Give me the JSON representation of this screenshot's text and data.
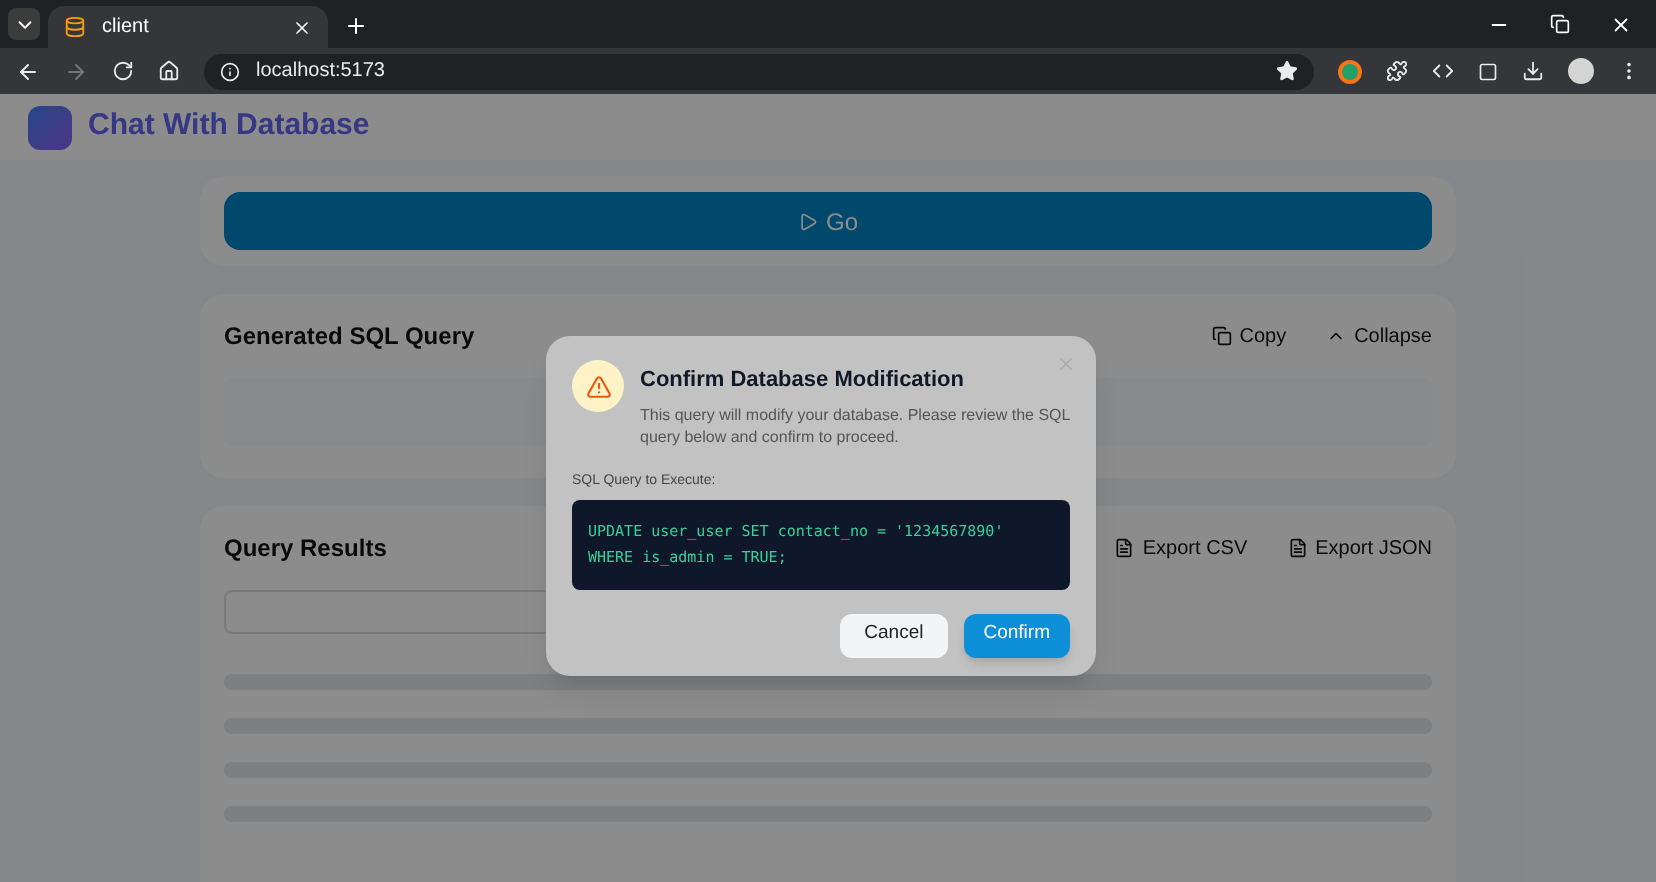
{
  "browser": {
    "tab_title": "client",
    "address": "localhost:5173"
  },
  "page": {
    "app_title": "Chat With Database",
    "go_button": "Go",
    "sql_card": {
      "title": "Generated SQL Query",
      "copy": "Copy",
      "collapse": "Collapse"
    },
    "results_card": {
      "title": "Query Results",
      "export_csv": "Export CSV",
      "export_json": "Export JSON"
    }
  },
  "dialog": {
    "title": "Confirm Database Modification",
    "message": "This query will modify your database. Please review the SQL query below and confirm to proceed.",
    "query_label": "SQL Query to Execute:",
    "query_lines": [
      "UPDATE user_user SET contact_no = '1234567890'",
      "WHERE is_admin = TRUE;"
    ],
    "cancel": "Cancel",
    "confirm": "Confirm"
  }
}
